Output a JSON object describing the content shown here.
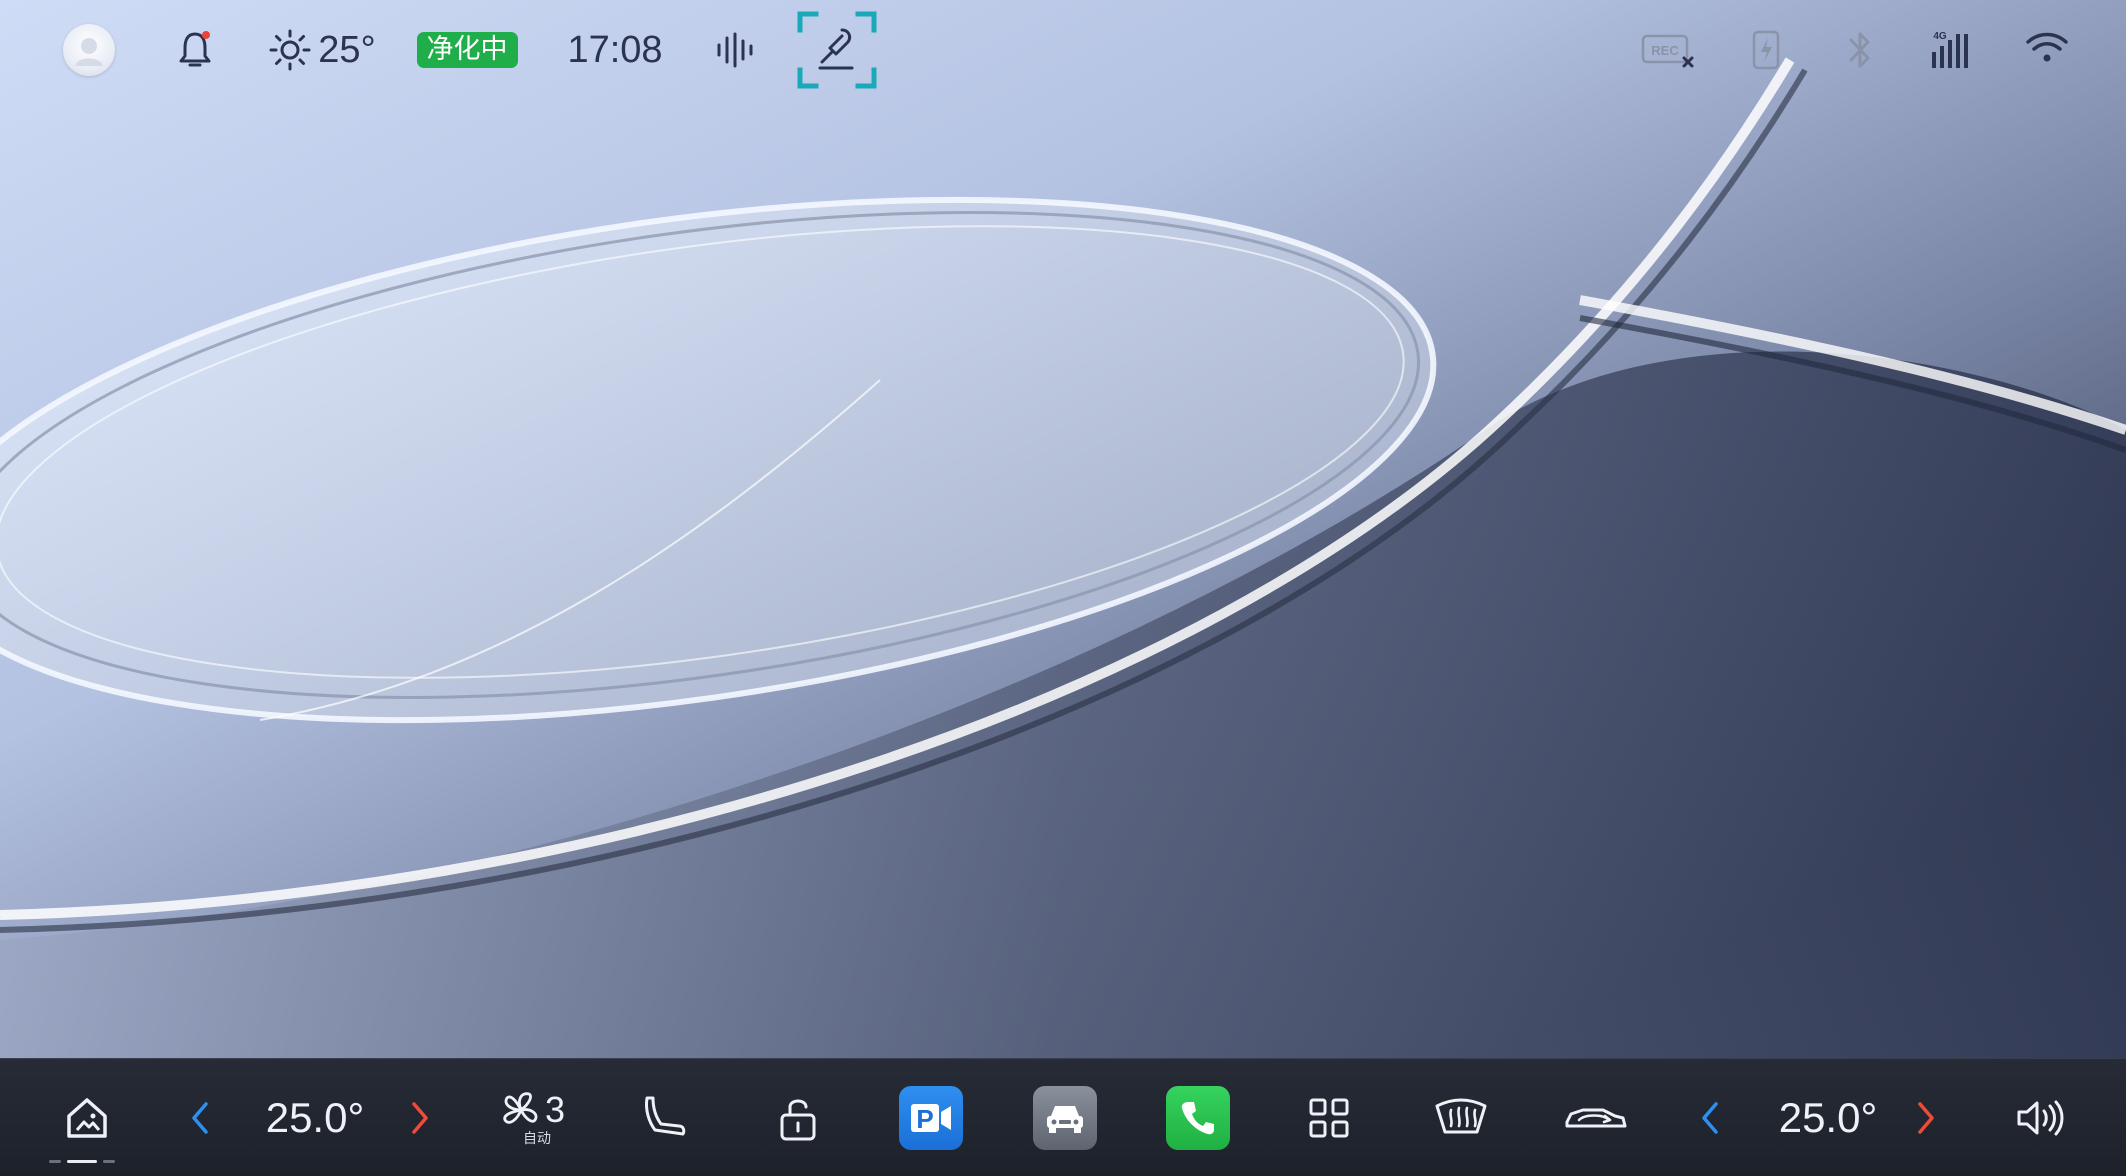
{
  "status_bar": {
    "weather": {
      "icon": "sun-icon",
      "temperature": "25°"
    },
    "purify_badge": "净化中",
    "clock": "17:08",
    "icons": [
      "avatar",
      "bell-icon",
      "voice-wave-icon",
      "voice-mic-icon",
      "rec-icon",
      "flash-charge-icon",
      "bluetooth-icon",
      "4g-signal-icon",
      "wifi-icon"
    ],
    "rec_label": "REC",
    "network_label": "4G",
    "notification_dot_color": "#e8443a"
  },
  "dock": {
    "left_temperature": "25.0°",
    "right_temperature": "25.0°",
    "fan_level": "3",
    "fan_mode": "自动",
    "park_label": "P",
    "decrease_arrow_color": "#2f8ff0",
    "increase_arrow_color": "#f04a3a",
    "items": [
      "home",
      "temp-decrease-left",
      "temp-left",
      "temp-increase-left",
      "fan",
      "seat",
      "lock",
      "parking-camera",
      "vehicle",
      "phone",
      "app-grid",
      "rear-defrost",
      "air-circulation",
      "temp-decrease-right",
      "temp-right",
      "temp-increase-right",
      "volume"
    ]
  },
  "colors": {
    "accent_mic_frame": "#1aa9b8",
    "purify_badge": "#1fae4a",
    "dock_background": "#1f232c"
  }
}
